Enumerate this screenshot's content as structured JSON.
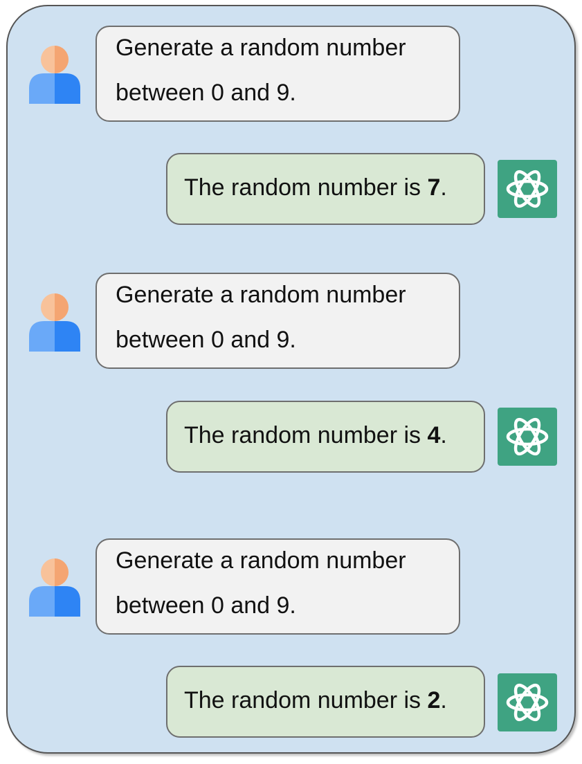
{
  "conversation": {
    "turns": [
      {
        "user": {
          "line1": "Generate a random number",
          "line2": "between 0 and 9."
        },
        "assistant": {
          "prefix": "The random number is ",
          "number": "7",
          "suffix": "."
        }
      },
      {
        "user": {
          "line1": "Generate a random number",
          "line2": "between 0 and 9."
        },
        "assistant": {
          "prefix": "The random number is ",
          "number": "4",
          "suffix": "."
        }
      },
      {
        "user": {
          "line1": "Generate a random number",
          "line2": "between 0 and 9."
        },
        "assistant": {
          "prefix": "The random number is ",
          "number": "2",
          "suffix": "."
        }
      }
    ]
  },
  "icons": {
    "user": "user-avatar-icon",
    "assistant": "chatgpt-logo-icon"
  },
  "colors": {
    "panel_background": "#cfe1f1",
    "user_bubble": "#f2f2f2",
    "assistant_bubble": "#d9e8d4",
    "logo_background": "#3fa382",
    "avatar_head": "#f4a979",
    "avatar_body": "#3d8df5"
  }
}
